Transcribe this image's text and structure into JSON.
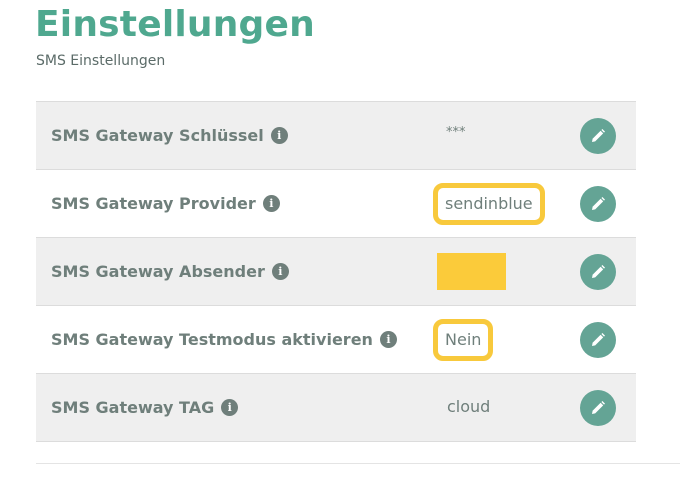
{
  "header": {
    "title": "Einstellungen",
    "subtitle": "SMS Einstellungen"
  },
  "settings": [
    {
      "label": "SMS Gateway Schlüssel",
      "value": "***",
      "highlighted": false,
      "redacted": false
    },
    {
      "label": "SMS Gateway Provider",
      "value": "sendinblue",
      "highlighted": true,
      "redacted": false
    },
    {
      "label": "SMS Gateway Absender",
      "value": "",
      "highlighted": false,
      "redacted": true
    },
    {
      "label": "SMS Gateway Testmodus aktivieren",
      "value": "Nein",
      "highlighted": true,
      "redacted": false
    },
    {
      "label": "SMS Gateway TAG",
      "value": "cloud",
      "highlighted": false,
      "redacted": false
    }
  ],
  "icons": {
    "info": "info-icon",
    "edit": "pencil-icon"
  },
  "colors": {
    "accent": "#4fa88f",
    "edit_button": "#64a495",
    "highlight": "#f8c93c",
    "row_shade": "#efefef",
    "text_muted": "#6f7f7b"
  }
}
